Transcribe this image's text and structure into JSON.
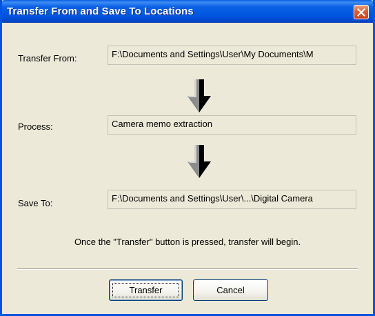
{
  "window": {
    "title": "Transfer From and Save To Locations",
    "close_icon": "close-x-icon"
  },
  "transfer_from": {
    "label": "Transfer From:",
    "value": "F:\\Documents and Settings\\User\\My Documents\\M"
  },
  "process": {
    "label": "Process:",
    "value": "Camera memo extraction"
  },
  "save_to": {
    "label": "Save To:",
    "value": "F:\\Documents and Settings\\User\\...\\Digital Camera"
  },
  "arrows": [
    "arrow-down-icon",
    "arrow-down-icon"
  ],
  "message": "Once the \"Transfer\" button is pressed, transfer will begin.",
  "buttons": {
    "transfer": "Transfer",
    "cancel": "Cancel"
  },
  "colors": {
    "titlebar": "#0055de",
    "window_bg": "#ece9d8",
    "close_button": "#d8603a"
  }
}
